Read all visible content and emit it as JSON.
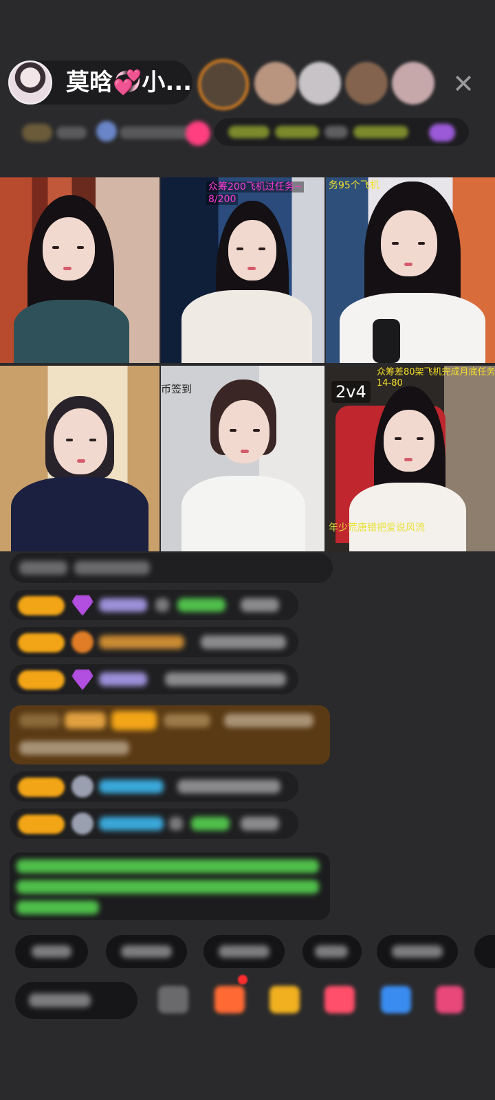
{
  "host": {
    "name": "莫晗💞小..."
  },
  "close_icon": "✕",
  "tiles": [
    {
      "label": "",
      "colors": {
        "bg1": "#6b2a1e",
        "bg2": "#c4563c",
        "shirt": "#2f5159"
      }
    },
    {
      "label": "众筹200飞机过任务~",
      "sub": "8/200",
      "colors": {
        "bg1": "#12233f",
        "bg2": "#284a7a",
        "shirt": "#efeae4"
      }
    },
    {
      "label": "务95个飞机",
      "colors": {
        "bg1": "#2d4f7a",
        "bg2": "#d86c3a",
        "shirt": "#f5f3f2"
      }
    },
    {
      "label": "",
      "colors": {
        "bg1": "#c9a06a",
        "bg2": "#f0e1c4",
        "shirt": "#1b2040"
      }
    },
    {
      "label": "币签到",
      "colors": {
        "bg1": "#dcdde0",
        "bg2": "#f0efee",
        "shirt": "#f4f4f2"
      }
    },
    {
      "label": "众筹差80架飞机完成月底任务",
      "sub": "14-80",
      "pk": "2v4",
      "footer": "年少荒唐错把爱说风流",
      "colors": {
        "bg1": "#3a3430",
        "bg2": "#7e6f62",
        "shirt": "#f4f1ec"
      }
    }
  ],
  "colors": {
    "background": "#2a2a2c",
    "badge_gold": "#f2a516",
    "diamond": "#b24ee0",
    "task_text_magenta": "#ff3bd6",
    "task_text_yellow": "#f5e02a",
    "chat_green": "#4fbf4a",
    "chat_blue": "#3aa7d8"
  }
}
